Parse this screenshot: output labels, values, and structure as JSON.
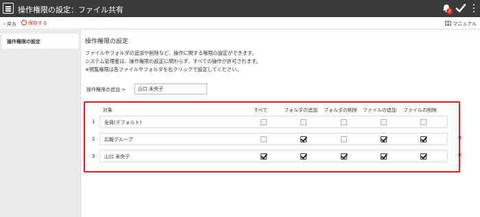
{
  "header": {
    "title": "操作権限の設定：ファイル共有",
    "badge_count": "2",
    "icons": [
      "menu-icon",
      "bell-icon",
      "check-icon",
      "kebab-icon"
    ]
  },
  "actionbar": {
    "back_label": "戻る",
    "save_label": "保存する",
    "manual_label": "マニュアル"
  },
  "sidebar": {
    "items": [
      {
        "label": "操作権限の設定",
        "active": true
      }
    ]
  },
  "main": {
    "title": "操作権限の設定",
    "desc": [
      "ファイルやフォルダの追加や削除など、操作に関する権限の設定ができます。",
      "システム管理者は、操作権限の設定に関わらず、すべての操作が許可されます。",
      "※閲覧権限は各ファイルやフォルダを右クリックで設定してください。"
    ],
    "add": {
      "label": "操作権限の追加 >",
      "value": "山口 未央子"
    }
  },
  "permissions": {
    "columns": [
      "対象",
      "すべて",
      "フォルダの追加",
      "フォルダの削除",
      "ファイルの追加",
      "ファイルの削除"
    ],
    "rows": [
      {
        "no": "1",
        "name": "全員(デフォルト)",
        "checks": [
          false,
          false,
          false,
          false,
          false
        ],
        "removable": false
      },
      {
        "no": "2",
        "name": "広報グループ",
        "checks": [
          false,
          true,
          false,
          true,
          true
        ],
        "removable": true
      },
      {
        "no": "3",
        "name": "山口 未央子",
        "checks": [
          true,
          true,
          true,
          true,
          true
        ],
        "removable": true
      }
    ],
    "remove_glyph": "×"
  },
  "colors": {
    "topbar": "#3a3a3a",
    "accent_red": "#e0201b",
    "badge": "#e0301e"
  }
}
